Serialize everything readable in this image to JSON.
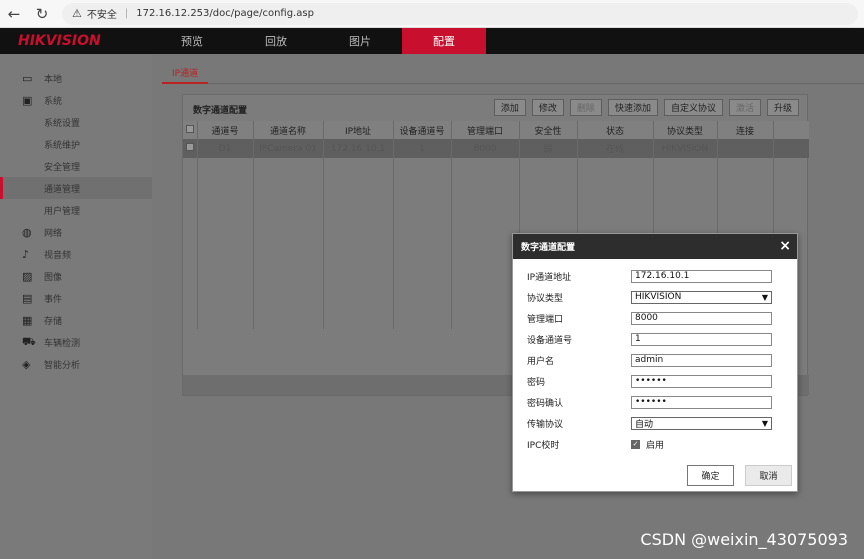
{
  "browser": {
    "back": "←",
    "reload": "↻",
    "insecure_label": "不安全",
    "url": "172.16.12.253/doc/page/config.asp"
  },
  "logo": "HIKVISION",
  "topnav": [
    {
      "label": "预览"
    },
    {
      "label": "回放"
    },
    {
      "label": "图片"
    },
    {
      "label": "配置"
    }
  ],
  "sidebar": {
    "items": [
      {
        "label": "本地",
        "icon": "monitor-icon"
      },
      {
        "label": "系统",
        "icon": "system-icon"
      },
      {
        "label": "系统设置"
      },
      {
        "label": "系统维护"
      },
      {
        "label": "安全管理"
      },
      {
        "label": "通道管理"
      },
      {
        "label": "用户管理"
      },
      {
        "label": "网络",
        "icon": "globe-icon"
      },
      {
        "label": "视音频",
        "icon": "audio-video-icon"
      },
      {
        "label": "图像",
        "icon": "image-icon"
      },
      {
        "label": "事件",
        "icon": "event-icon"
      },
      {
        "label": "存储",
        "icon": "storage-icon"
      },
      {
        "label": "车辆检测",
        "icon": "vehicle-icon"
      },
      {
        "label": "智能分析",
        "icon": "analysis-icon"
      }
    ]
  },
  "tab": {
    "label": "IP通道"
  },
  "panel": {
    "title": "数字通道配置",
    "buttons": [
      "添加",
      "修改",
      "删除",
      "快速添加",
      "自定义协议",
      "激活",
      "升级"
    ],
    "columns": [
      "通道号",
      "通道名称",
      "IP地址",
      "设备通道号",
      "管理端口",
      "安全性",
      "状态",
      "协议类型",
      "连接"
    ],
    "rows": [
      [
        "D1",
        "IPCamera 01",
        "172.16.10.1",
        "1",
        "8000",
        "弱",
        "在线",
        "HIKVISION",
        ""
      ]
    ]
  },
  "modal": {
    "title": "数字通道配置",
    "close": "×",
    "fields": {
      "ip_label": "IP通道地址",
      "ip_value": "172.16.10.1",
      "protocol_label": "协议类型",
      "protocol_value": "HIKVISION",
      "port_label": "管理端口",
      "port_value": "8000",
      "channel_label": "设备通道号",
      "channel_value": "1",
      "user_label": "用户名",
      "user_value": "admin",
      "pwd_label": "密码",
      "pwd_value": "••••••",
      "pwd2_label": "密码确认",
      "pwd2_value": "••••••",
      "transport_label": "传输协议",
      "transport_value": "自动",
      "ipc_label": "IPC校时",
      "ipc_check": "✓",
      "ipc_enable": "启用"
    },
    "ok": "确定",
    "cancel": "取消"
  },
  "watermark": "CSDN @weixin_43075093"
}
